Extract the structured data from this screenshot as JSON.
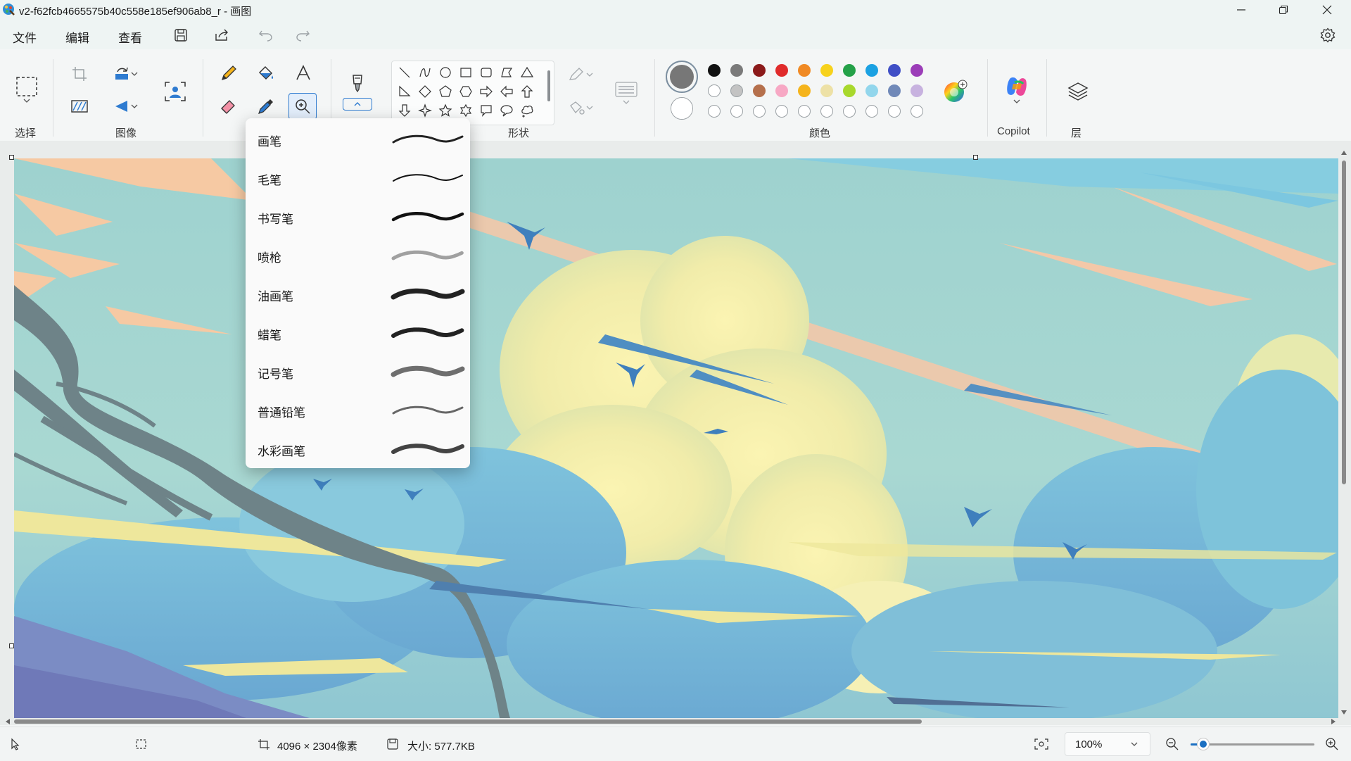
{
  "window": {
    "title": "v2-f62fcb4665575b40c558e185ef906ab8_r - 画图",
    "controls": [
      "minimize",
      "restore",
      "close"
    ]
  },
  "menu": {
    "file": "文件",
    "edit": "编辑",
    "view": "查看"
  },
  "quick_access": [
    "save-icon",
    "share-icon",
    "undo-icon",
    "redo-icon"
  ],
  "settings_icon": "gear-icon",
  "ribbon": {
    "groups": {
      "select": "选择",
      "image": "图像",
      "shapes": "形状",
      "colors": "颜色",
      "copilot": "Copilot",
      "layers": "层"
    },
    "tools": [
      "pencil-icon",
      "fill-icon",
      "text-icon",
      "eraser-icon",
      "color-picker-icon",
      "magnifier-icon",
      "brush-icon"
    ],
    "shapes": [
      "line",
      "curve",
      "oval",
      "rectangle",
      "rounded-rectangle",
      "polygon",
      "triangle",
      "right-triangle",
      "diamond",
      "pentagon",
      "hexagon",
      "right-arrow",
      "left-arrow",
      "up-arrow",
      "down-arrow",
      "four-point-star",
      "five-point-star",
      "six-point-star",
      "rect-callout",
      "oval-callout",
      "cloud-callout"
    ],
    "colors": {
      "primary": "#777777",
      "secondary": "#ffffff",
      "row1": [
        "#111111",
        "#7a7a7a",
        "#8b1a1a",
        "#e02b2b",
        "#f08a24",
        "#f7d21c",
        "#24a148",
        "#1ba1e2",
        "#3f4fc6",
        "#9b3db8"
      ],
      "row2": [
        "#ffffff",
        "#c3c3c3",
        "#b5704c",
        "#f7a8c4",
        "#f5b41c",
        "#ede1a6",
        "#a8d82c",
        "#92d6ec",
        "#7089b8",
        "#c7b2df"
      ],
      "row3": [
        "#ffffff",
        "#ffffff",
        "#ffffff",
        "#ffffff",
        "#ffffff",
        "#ffffff",
        "#ffffff",
        "#ffffff",
        "#ffffff",
        "#ffffff"
      ]
    }
  },
  "brush_menu": {
    "items": [
      {
        "label": "画笔",
        "style": "brush"
      },
      {
        "label": "毛笔",
        "style": "calligraphy"
      },
      {
        "label": "书写笔",
        "style": "pen"
      },
      {
        "label": "喷枪",
        "style": "airbrush"
      },
      {
        "label": "油画笔",
        "style": "oil"
      },
      {
        "label": "蜡笔",
        "style": "crayon"
      },
      {
        "label": "记号笔",
        "style": "marker"
      },
      {
        "label": "普通铅笔",
        "style": "pencil"
      },
      {
        "label": "水彩画笔",
        "style": "watercolor"
      }
    ]
  },
  "status": {
    "dimensions": "4096 × 2304像素",
    "size": "大小: 577.7KB",
    "zoom": "100%",
    "zoom_level": 0.1
  }
}
